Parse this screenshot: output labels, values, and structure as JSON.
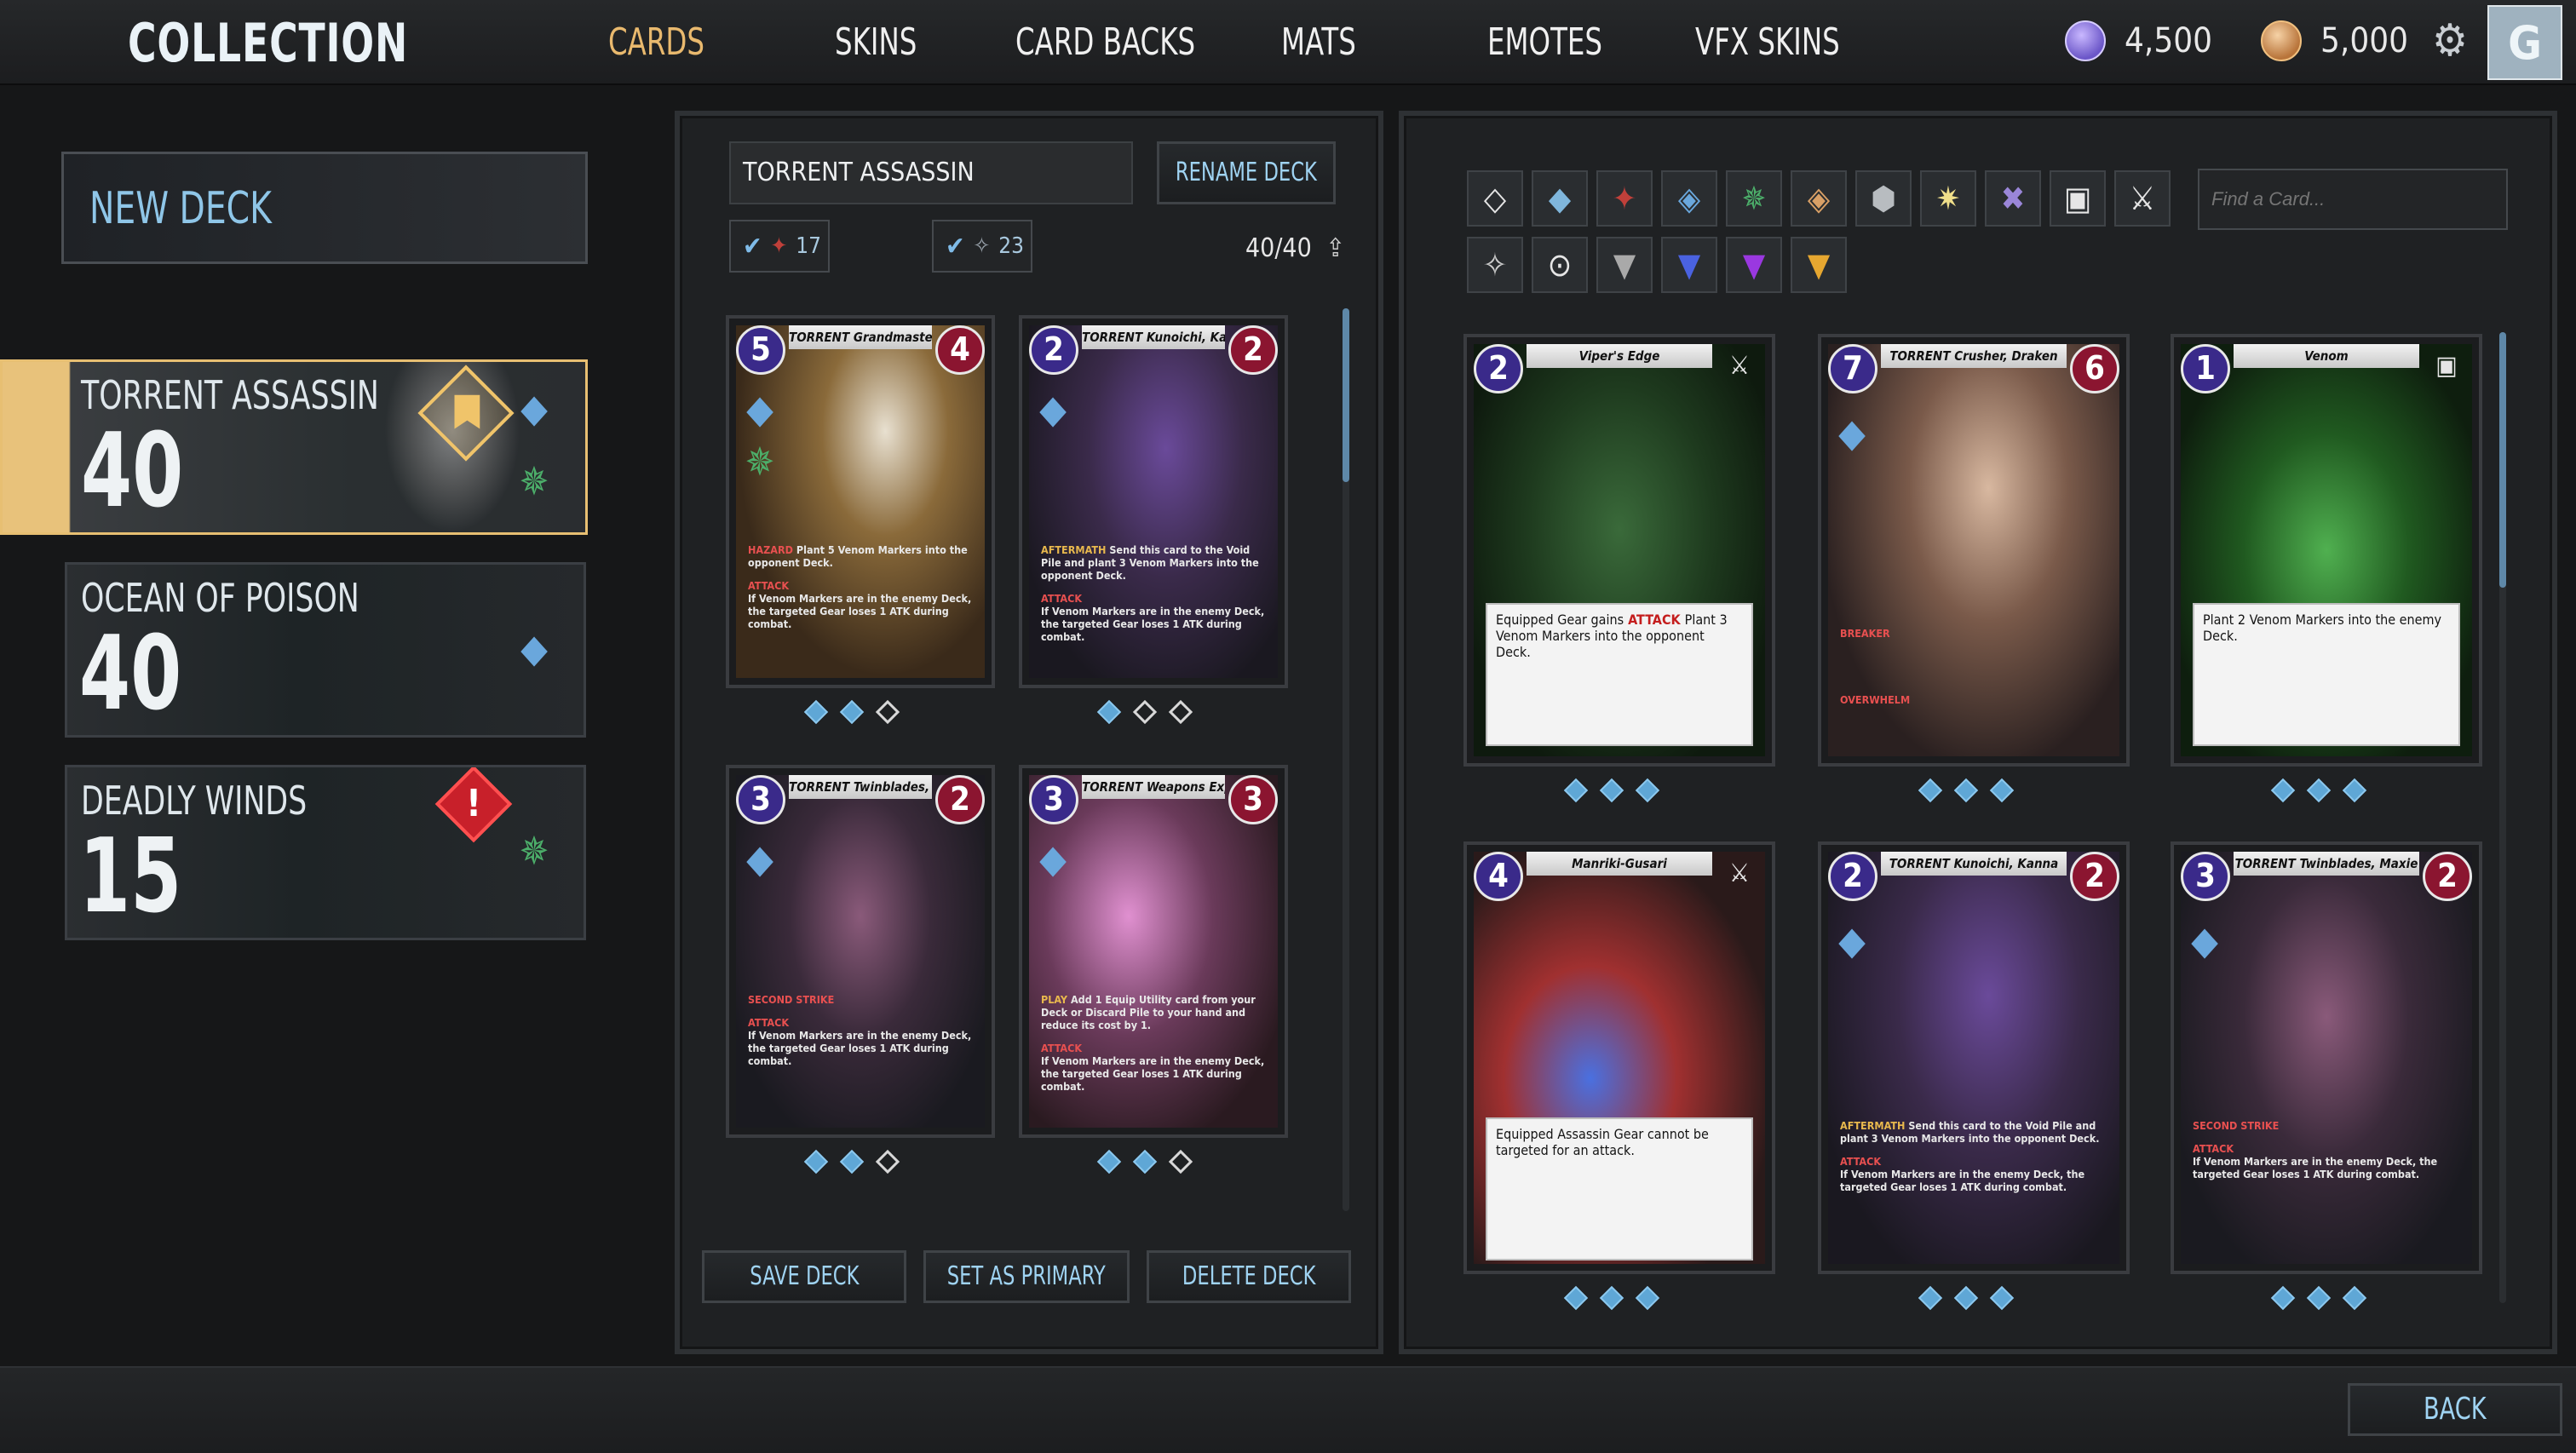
{
  "topbar": {
    "title": "COLLECTION",
    "tabs": [
      "CARDS",
      "SKINS",
      "CARD BACKS",
      "MATS",
      "EMOTES",
      "VFX SKINS"
    ],
    "active_tab": "CARDS",
    "currency_a": "4,500",
    "currency_b": "5,000"
  },
  "decklist": {
    "new_deck": "NEW DECK",
    "decks": [
      {
        "name": "TORRENT ASSASSIN",
        "count": "40"
      },
      {
        "name": "OCEAN OF POISON",
        "count": "40"
      },
      {
        "name": "DEADLY WINDS",
        "count": "15"
      }
    ]
  },
  "editor": {
    "deck_name": "TORRENT ASSASSIN",
    "rename_label": "RENAME DECK",
    "filter_a_count": "17",
    "filter_b_count": "23",
    "card_total": "40/40",
    "save_label": "SAVE DECK",
    "primary_label": "SET AS PRIMARY",
    "delete_label": "DELETE DECK"
  },
  "deck_cards": [
    {
      "name": "TORRENT Grandmaster, Raine",
      "cost": "5",
      "atk": "4",
      "text1_kw": "HAZARD",
      "text1": "Plant 5 Venom Markers into the opponent Deck.",
      "text2_kw": "ATTACK",
      "text2": "If Venom Markers are in the enemy Deck, the targeted Gear loses 1 ATK during combat.",
      "owned": 2
    },
    {
      "name": "TORRENT Kunoichi, Kanna",
      "cost": "2",
      "atk": "2",
      "text1_kw": "AFTERMATH",
      "text1": "Send this card to the Void Pile and plant 3 Venom Markers into the opponent Deck.",
      "text2_kw": "ATTACK",
      "text2": "If Venom Markers are in the enemy Deck, the targeted Gear loses 1 ATK during combat.",
      "owned": 1
    },
    {
      "name": "TORRENT Twinblades, Maxie",
      "cost": "3",
      "atk": "2",
      "text1_kw": "SECOND STRIKE",
      "text1": "",
      "text2_kw": "ATTACK",
      "text2": "If Venom Markers are in the enemy Deck, the targeted Gear loses 1 ATK during combat.",
      "owned": 2
    },
    {
      "name": "TORRENT Weapons Expert, Bri",
      "cost": "3",
      "atk": "3",
      "text1_kw": "PLAY",
      "text1": "Add 1 Equip Utility card from your Deck or Discard Pile to your hand and reduce its cost by 1.",
      "text2_kw": "ATTACK",
      "text2": "If Venom Markers are in the enemy Deck, the targeted Gear loses 1 ATK during combat.",
      "owned": 2
    }
  ],
  "collection": {
    "search_placeholder": "Find a Card...",
    "cards": [
      {
        "name": "Viper's Edge",
        "cost": "2",
        "text": "Equipped Gear gains",
        "text_kw": "ATTACK",
        "text_after": "Plant 3 Venom Markers into the opponent Deck.",
        "owned": 3
      },
      {
        "name": "TORRENT Crusher, Draken",
        "cost": "7",
        "atk": "6",
        "kw1": "BREAKER",
        "kw2": "OVERWHELM",
        "owned": 3
      },
      {
        "name": "Venom",
        "cost": "1",
        "text": "Plant 2 Venom Markers into the enemy Deck.",
        "owned": 3
      },
      {
        "name": "Manriki-Gusari",
        "cost": "4",
        "text": "Equipped Assassin Gear cannot be targeted for an attack.",
        "owned": 3
      },
      {
        "name": "TORRENT Kunoichi, Kanna",
        "cost": "2",
        "atk": "2",
        "text1_kw": "AFTERMATH",
        "text1": "Send this card to the Void Pile and plant 3 Venom Markers into the opponent Deck.",
        "text2_kw": "ATTACK",
        "text2": "If Venom Markers are in the enemy Deck, the targeted Gear loses 1 ATK during combat.",
        "owned": 3
      },
      {
        "name": "TORRENT Twinblades, Maxie",
        "cost": "3",
        "atk": "2",
        "text1_kw": "SECOND STRIKE",
        "text1": "",
        "text2_kw": "ATTACK",
        "text2": "If Venom Markers are in the enemy Deck, the targeted Gear loses 1 ATK during combat.",
        "owned": 3
      }
    ]
  },
  "back_label": "BACK"
}
